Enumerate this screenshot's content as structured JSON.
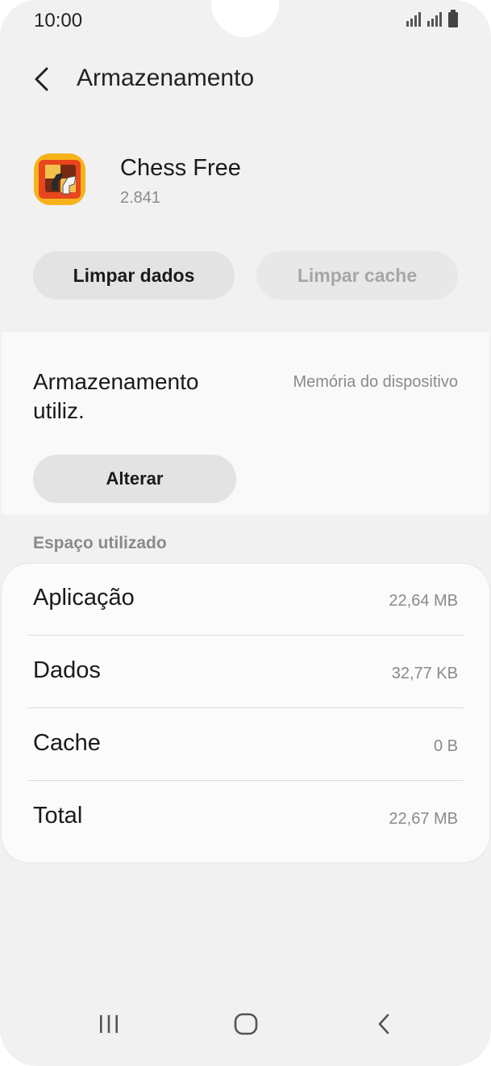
{
  "status_bar": {
    "time": "10:00"
  },
  "header": {
    "title": "Armazenamento"
  },
  "app": {
    "name": "Chess Free",
    "version": "2.841"
  },
  "actions": {
    "clear_data": "Limpar dados",
    "clear_cache": "Limpar cache"
  },
  "storage": {
    "label": "Armazenamento utiliz.",
    "value": "Memória do dispositivo",
    "change_button": "Alterar"
  },
  "usage": {
    "section_title": "Espaço utilizado",
    "rows": [
      {
        "label": "Aplicação",
        "value": "22,64 MB"
      },
      {
        "label": "Dados",
        "value": "32,77 KB"
      },
      {
        "label": "Cache",
        "value": "0 B"
      },
      {
        "label": "Total",
        "value": "22,67 MB"
      }
    ]
  },
  "icons": {
    "back": "back-arrow-icon",
    "signal": "signal-icon",
    "battery": "battery-icon",
    "recents": "recent-apps-icon",
    "home": "home-icon",
    "nav_back": "nav-back-icon"
  },
  "colors": {
    "background": "#f1f1f1",
    "card": "#f9f9f9",
    "button": "#e3e3e3",
    "disabled_text": "#a6a6a6",
    "secondary_text": "#8a8a8a"
  }
}
